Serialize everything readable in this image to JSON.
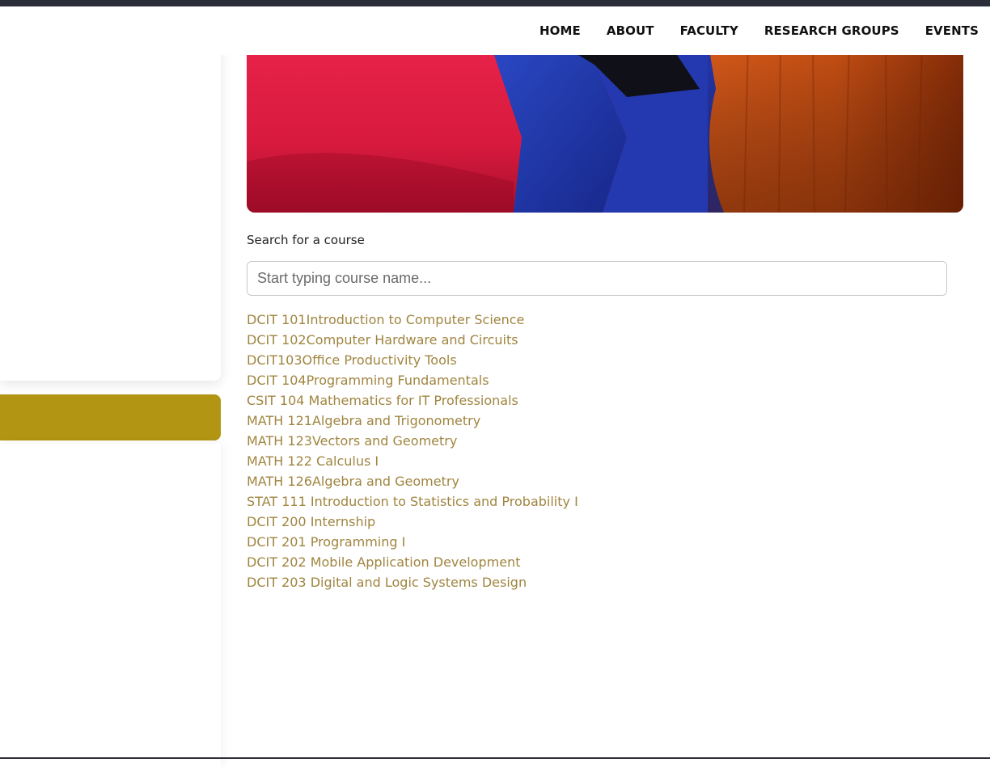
{
  "nav": {
    "items": [
      {
        "label": "HOME"
      },
      {
        "label": "ABOUT"
      },
      {
        "label": "FACULTY"
      },
      {
        "label": "RESEARCH GROUPS"
      },
      {
        "label": "EVENTS"
      }
    ]
  },
  "search": {
    "label": "Search for a course",
    "placeholder": "Start typing course name...",
    "value": ""
  },
  "courses": [
    "DCIT 101Introduction to Computer Science",
    "DCIT 102Computer Hardware and Circuits",
    "DCIT103Office Productivity Tools",
    "DCIT 104Programming Fundamentals",
    "CSIT 104 Mathematics for IT Professionals",
    "MATH 121Algebra and Trigonometry",
    "MATH 123Vectors and Geometry",
    "MATH 122 Calculus I",
    "MATH 126Algebra and Geometry",
    "STAT 111 Introduction to Statistics and Probability I",
    "DCIT 200 Internship",
    "DCIT 201 Programming I",
    "DCIT 202 Mobile Application Development",
    "DCIT 203 Digital and Logic Systems Design"
  ],
  "colors": {
    "accent": "#b19513",
    "course_link": "#a08540",
    "topbar": "#2b2d38"
  }
}
